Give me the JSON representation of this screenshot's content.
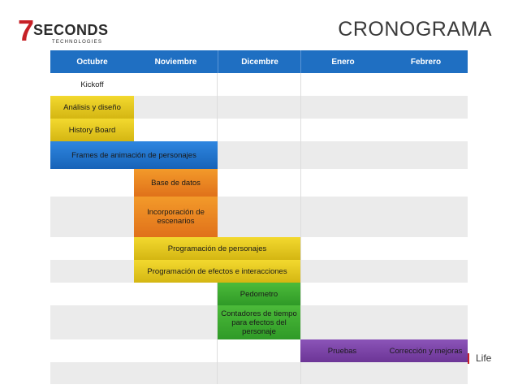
{
  "brand": {
    "seven": "7",
    "name": "SECONDS",
    "tagline": "TECHNOLOGIES"
  },
  "title": "CRONOGRAMA",
  "months": [
    "Octubre",
    "Noviembre",
    "Dicembre",
    "Enero",
    "Febrero"
  ],
  "tasks": {
    "kickoff": "Kickoff",
    "analisis": "Análisis y diseño",
    "history": "History Board",
    "frames": "Frames de animación de personajes",
    "base": "Base de datos",
    "incorporacion": "Incorporación de escenarios",
    "prog_personajes": "Programación de personajes",
    "prog_efectos": "Programación de efectos e interacciones",
    "pedometro": "Pedometro",
    "contadores": "Contadores de tiempo para efectos del personaje",
    "pruebas": "Pruebas",
    "correccion": "Corrección y mejoras"
  },
  "footer": {
    "text": "Life"
  },
  "colors": {
    "header": "#1f6fc2",
    "yellow": "#e6c81f",
    "blue": "#2278d0",
    "orange": "#ea8420",
    "green": "#3aa92f",
    "purple": "#7a44a6",
    "logo_red": "#c62026"
  }
}
